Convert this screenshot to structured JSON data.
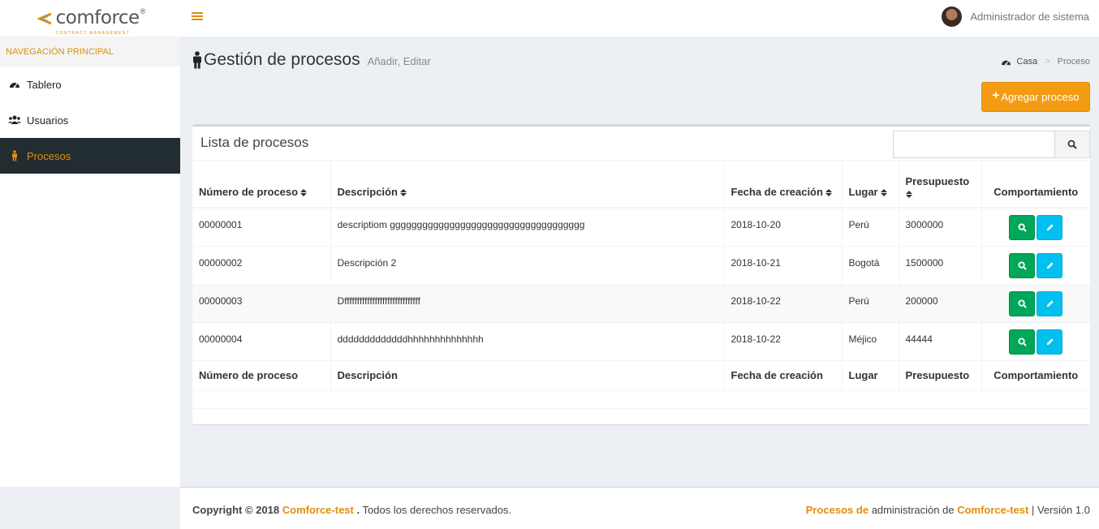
{
  "brand": {
    "name": "comforce",
    "reg": "®",
    "tagline": "CONTRACT MANAGEMENT"
  },
  "header": {
    "user_name": "Administrador de sistema"
  },
  "sidebar": {
    "section": "NAVEGACIÓN PRINCIPAL",
    "items": [
      {
        "label": "Tablero",
        "icon": "dashboard-icon"
      },
      {
        "label": "Usuarios",
        "icon": "users-icon"
      },
      {
        "label": "Procesos",
        "icon": "person-icon",
        "active": true
      }
    ]
  },
  "page": {
    "title": "Gestión de procesos",
    "subtitle": "Añadir, Editar",
    "breadcrumb": {
      "home": "Casa",
      "sep": ">",
      "current": "Proceso"
    },
    "add_button": "Agregar proceso",
    "add_button_plus": "+"
  },
  "box": {
    "title": "Lista de procesos",
    "search_value": "",
    "columns": [
      "Número de proceso",
      "Descripción",
      "Fecha de creación",
      "Lugar",
      "Presupuesto",
      "Comportamiento"
    ],
    "rows": [
      {
        "numero": "00000001",
        "descripcion": "descriptiom gggggggggggggggggggggggggggggggggggg",
        "fecha": "2018-10-20",
        "lugar": "Perú",
        "presupuesto": "3000000"
      },
      {
        "numero": "00000002",
        "descripcion": "Descripción 2",
        "fecha": "2018-10-21",
        "lugar": "Bogotá",
        "presupuesto": "1500000"
      },
      {
        "numero": "00000003",
        "descripcion": "Dffffffffffffffffffffffffffffff",
        "fecha": "2018-10-22",
        "lugar": "Perú",
        "presupuesto": "200000"
      },
      {
        "numero": "00000004",
        "descripcion": "dddddddddddddhhhhhhhhhhhhhh",
        "fecha": "2018-10-22",
        "lugar": "Méjico",
        "presupuesto": "44444"
      }
    ]
  },
  "footer": {
    "copyright": "Copyright © 2018",
    "company": "Comforce-test",
    "dot": ".",
    "rights": "Todos los derechos reservados.",
    "right_a": "Procesos de",
    "right_b": "administración de",
    "right_c": "Comforce-test",
    "version": "| Versión 1.0"
  },
  "colors": {
    "accent": "#f39c12",
    "sidebar_active": "#222d32",
    "view": "#00a65a",
    "edit": "#00c0ef"
  }
}
